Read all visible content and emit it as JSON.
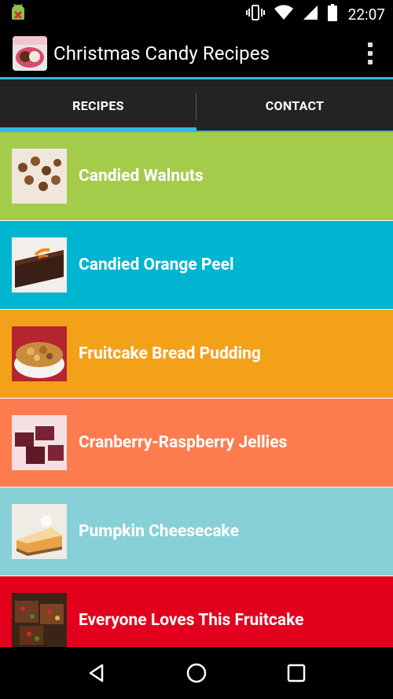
{
  "status_bar": {
    "time": "22:07",
    "icons": [
      "android-debug-icon",
      "vibrate-icon",
      "wifi-icon",
      "signal-icon",
      "battery-icon"
    ]
  },
  "action_bar": {
    "title": "Christmas Candy Recipes",
    "app_icon": "app-logo",
    "overflow_icon": "overflow-menu-icon"
  },
  "tabs": [
    {
      "label": "RECIPES",
      "selected": true
    },
    {
      "label": "CONTACT",
      "selected": false
    }
  ],
  "accent_color": "#33b5e5",
  "recipes": [
    {
      "title": "Candied Walnuts",
      "color": "#a5cb4b"
    },
    {
      "title": "Candied Orange Peel",
      "color": "#00b5d0"
    },
    {
      "title": "Fruitcake Bread Pudding",
      "color": "#f4a11a"
    },
    {
      "title": "Cranberry-Raspberry Jellies",
      "color": "#fc7c50"
    },
    {
      "title": "Pumpkin Cheesecake",
      "color": "#87d0d7"
    },
    {
      "title": "Everyone Loves This Fruitcake",
      "color": "#e3001d"
    }
  ],
  "nav_bar": {
    "buttons": [
      "back-icon",
      "home-icon",
      "recents-icon"
    ]
  }
}
